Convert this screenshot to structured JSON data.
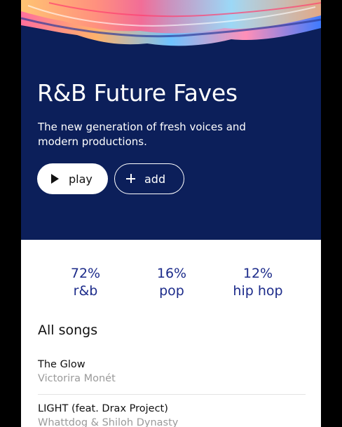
{
  "playlist": {
    "title": "R&B Future Faves",
    "description": "The new generation of fresh voices and modern productions."
  },
  "actions": {
    "play_label": "play",
    "add_label": "add",
    "play_icon": "play-icon",
    "add_icon": "plus-icon"
  },
  "genres": [
    {
      "percent": "72%",
      "name": "r&b"
    },
    {
      "percent": "16%",
      "name": "pop"
    },
    {
      "percent": "12%",
      "name": "hip hop"
    }
  ],
  "songs_section": {
    "title": "All songs",
    "songs": [
      {
        "title": "The Glow",
        "artist": "Victorira Monét"
      },
      {
        "title": "LIGHT (feat. Drax Project)",
        "artist": "Whattdog & Shiloh Dynasty"
      }
    ]
  },
  "colors": {
    "hero_background": "#0c1f5a",
    "accent_text": "#1c2b8a",
    "secondary_text": "#9a9a9a"
  }
}
